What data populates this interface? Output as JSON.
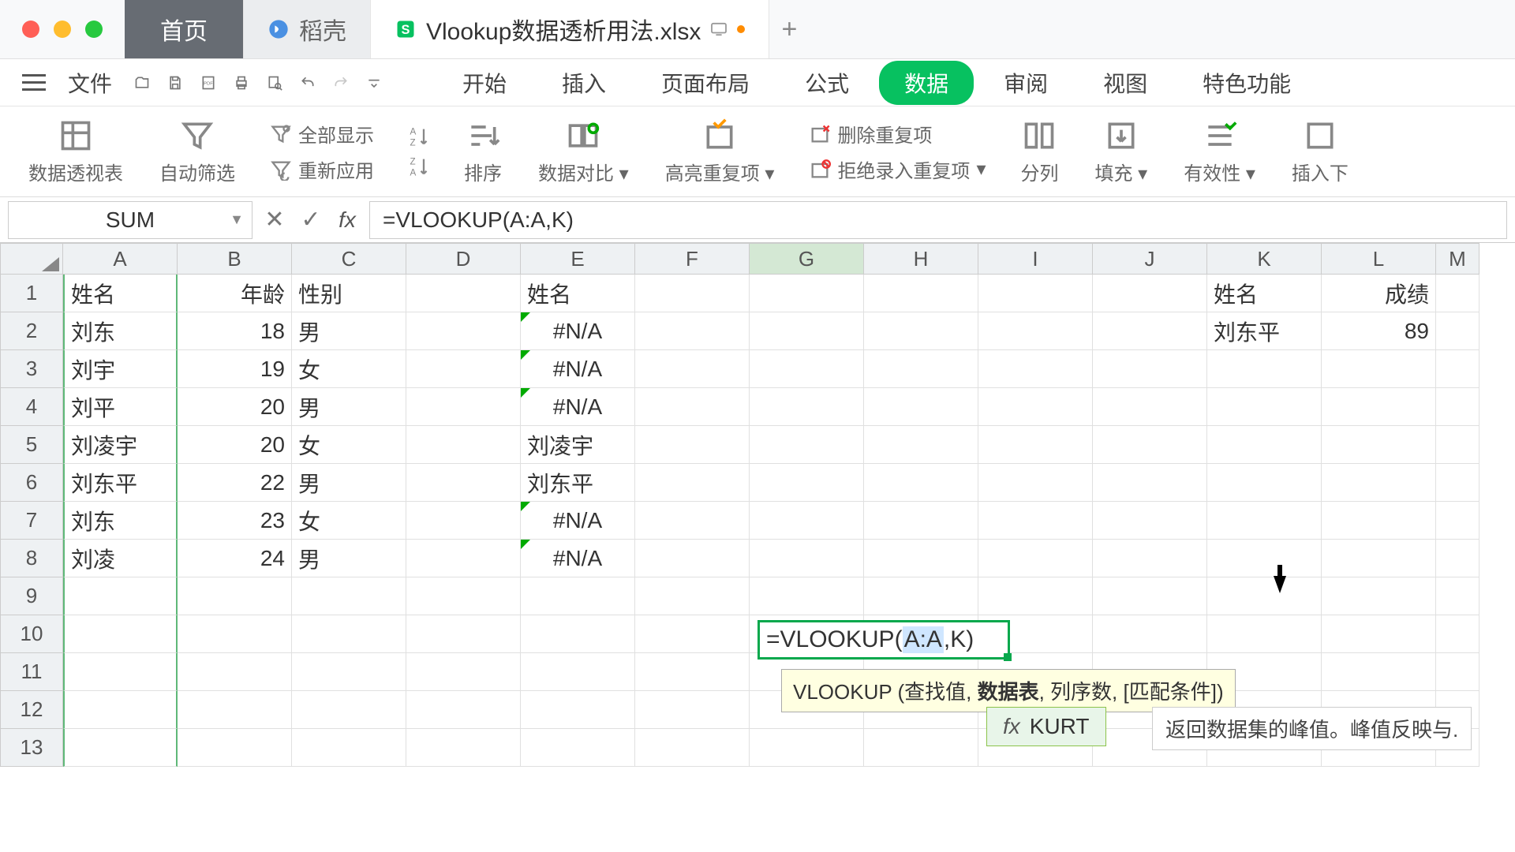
{
  "window": {
    "tabs": {
      "home": "首页",
      "daoke": "稻壳",
      "file": "Vlookup数据透析用法.xlsx"
    }
  },
  "menu": {
    "file": "文件",
    "tabs": [
      "开始",
      "插入",
      "页面布局",
      "公式",
      "数据",
      "审阅",
      "视图",
      "特色功能"
    ]
  },
  "ribbon": {
    "pivot": "数据透视表",
    "autofilter": "自动筛选",
    "showall": "全部显示",
    "reapply": "重新应用",
    "sort_az": "A↓Z",
    "sort_za": "Z↓A",
    "sort": "排序",
    "compare": "数据对比",
    "highlight_dup": "高亮重复项",
    "remove_dup": "删除重复项",
    "reject_dup": "拒绝录入重复项",
    "split": "分列",
    "fill": "填充",
    "validity": "有效性",
    "insert_drop": "插入下"
  },
  "formula_bar": {
    "name": "SUM",
    "formula": "=VLOOKUP(A:A,K)"
  },
  "columns": [
    "A",
    "B",
    "C",
    "D",
    "E",
    "F",
    "G",
    "H",
    "I",
    "J",
    "K",
    "L",
    "M"
  ],
  "row_numbers": [
    "1",
    "2",
    "3",
    "4",
    "5",
    "6",
    "7",
    "8",
    "9",
    "10",
    "11",
    "12",
    "13"
  ],
  "data": {
    "A1": "姓名",
    "B1": "年龄",
    "C1": "性别",
    "E1": "姓名",
    "K1": "姓名",
    "L1": "成绩",
    "A2": "刘东",
    "B2": "18",
    "C2": "男",
    "E2": "#N/A",
    "K2": "刘东平",
    "L2": "89",
    "A3": "刘宇",
    "B3": "19",
    "C3": "女",
    "E3": "#N/A",
    "A4": "刘平",
    "B4": "20",
    "C4": "男",
    "E4": "#N/A",
    "A5": "刘凌宇",
    "B5": "20",
    "C5": "女",
    "E5": "刘凌宇",
    "A6": "刘东平",
    "B6": "22",
    "C6": "男",
    "E6": "刘东平",
    "A7": "刘东",
    "B7": "23",
    "C7": "女",
    "E7": "#N/A",
    "A8": "刘凌",
    "B8": "24",
    "C8": "男",
    "E8": "#N/A"
  },
  "editing": {
    "prefix": "=VLOOKUP(",
    "ref": "A:A",
    "suffix": ",K)"
  },
  "tooltip": {
    "fn": "VLOOKUP",
    "args_open": " (查找值, ",
    "arg_bold": "数据表",
    "args_rest": ", 列序数, [匹配条件])"
  },
  "suggest": {
    "fn": "KURT"
  },
  "desc": "返回数据集的峰值。峰值反映与."
}
